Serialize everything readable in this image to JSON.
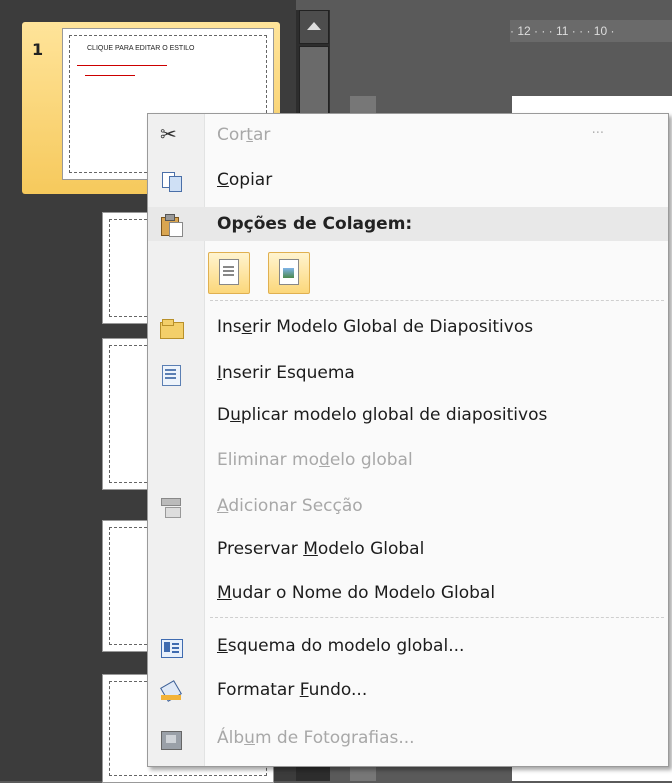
{
  "slides_panel": {
    "selected_number": "1",
    "selected_title": "CLIQUE PARA EDITAR O ESTILO"
  },
  "ruler": {
    "text": "· 12 · · · 11 · · · 10 ·"
  },
  "context_menu": {
    "items": [
      {
        "pre": "Cor",
        "key": "t",
        "post": "ar",
        "icon": "scissors-icon",
        "disabled": true
      },
      {
        "pre": "",
        "key": "C",
        "post": "opiar",
        "icon": "copy-icon",
        "disabled": false
      },
      {
        "pre": "Opções de Colagem:",
        "key": "",
        "post": "",
        "icon": "paste-icon",
        "disabled": false
      },
      {
        "pre": "Ins",
        "key": "e",
        "post": "rir Modelo Global de Diapositivos",
        "icon": "insert-master-icon",
        "disabled": false
      },
      {
        "pre": "",
        "key": "I",
        "post": "nserir Esquema",
        "icon": "insert-layout-icon",
        "disabled": false
      },
      {
        "pre": "D",
        "key": "u",
        "post": "plicar modelo global de diapositivos",
        "icon": "",
        "disabled": false
      },
      {
        "pre": "Eliminar mo",
        "key": "d",
        "post": "elo global",
        "icon": "",
        "disabled": true
      },
      {
        "pre": "",
        "key": "A",
        "post": "dicionar Secção",
        "icon": "section-icon",
        "disabled": true
      },
      {
        "pre": "Preservar ",
        "key": "M",
        "post": "odelo Global",
        "icon": "",
        "disabled": false
      },
      {
        "pre": "",
        "key": "M",
        "post": "udar o Nome do Modelo Global",
        "icon": "",
        "disabled": false
      },
      {
        "pre": "",
        "key": "E",
        "post": "squema do modelo global...",
        "icon": "master-layout-icon",
        "disabled": false
      },
      {
        "pre": "Formatar ",
        "key": "F",
        "post": "undo...",
        "icon": "format-background-icon",
        "disabled": false
      },
      {
        "pre": "Álb",
        "key": "u",
        "post": "m de Fotografias...",
        "icon": "photo-album-icon",
        "disabled": true
      }
    ],
    "cut_shortcut": "···"
  },
  "colors": {
    "panel_bg": "#3c3c3c",
    "selection": "#f6c95c",
    "menu_bg": "#fafafa",
    "disabled_text": "#a8a8a8"
  }
}
